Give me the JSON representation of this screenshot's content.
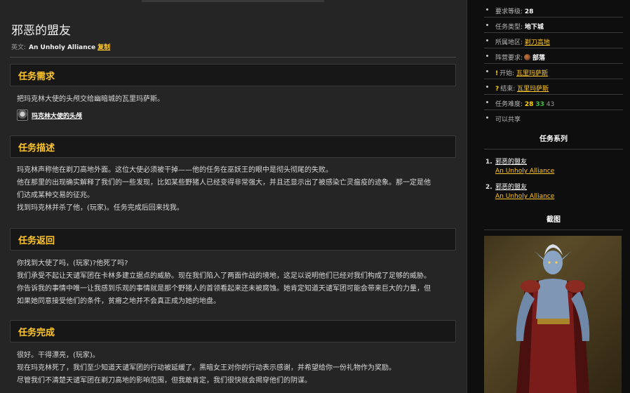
{
  "quest": {
    "title": "邪恶的盟友",
    "en_label": "英文:",
    "en_name": "An Unholy Alliance",
    "copy_label": "复制"
  },
  "sections": {
    "requirements": {
      "heading": "任务需求",
      "text": "把玛克林大使的头颅交给幽暗城的瓦里玛萨斯。",
      "item_name": "玛克林大使的头颅",
      "item_icon": "severed-head-icon"
    },
    "description": {
      "heading": "任务描述",
      "lines": [
        "玛克林声称他在剃刀高地外面。这位大使必须被干掉——他的任务在巫妖王的眼中是彻头彻尾的失败。",
        "他在那里的出现确实解释了我们的一些发现，比如某些野猪人已经变得非常强大，并且还显示出了被感染亡灵瘟疫的迹象。那一定是他",
        "们达成某种交易的征兆。",
        "找到玛克林并杀了他，(玩家)。任务完成后回来找我。"
      ]
    },
    "progress": {
      "heading": "任务返回",
      "lines": [
        "你找到大使了吗，(玩家)?他死了吗?",
        "我们承受不起让天谴军团在卡林多建立据点的威胁。现在我们陷入了两面作战的境地，这足以说明他们已经对我们构成了足够的威胁。",
        "你告诉我的事情中唯一让我感到乐观的事情就是那个野猪人的首领看起来还未被腐蚀。她肯定知道天谴军团可能会带来巨大的力量，但",
        "如果她同意接受他们的条件，贫瘠之地并不会真正成为她的地盘。"
      ]
    },
    "completion": {
      "heading": "任务完成",
      "lines": [
        "很好。干得漂亮，(玩家)。",
        "现在玛克林死了，我们至少知道天谴军团的行动被延缓了。黑暗女王对你的行动表示感谢，并希望给你一份礼物作为奖励。",
        "尽管我们不清楚天谴军团在剃刀高地的影响范围，但我敢肯定，我们很快就会揭穿他们的阴谋。"
      ]
    }
  },
  "sidebar": {
    "info": [
      {
        "label": "要求等级:",
        "value": "28"
      },
      {
        "label": "任务类型:",
        "value": "地下城"
      },
      {
        "label": "所属地区:",
        "value": "剃刀高地"
      },
      {
        "label": "阵营要求:",
        "value": "部落"
      },
      {
        "label": "开始:",
        "value": "瓦里玛萨斯"
      },
      {
        "label": "结束:",
        "value": "瓦里玛萨斯"
      },
      {
        "label": "任务难度:",
        "values": [
          "28",
          "33",
          "43"
        ]
      },
      {
        "label": "可以共享"
      }
    ],
    "series_heading": "任务系列",
    "series": [
      {
        "num": "1.",
        "zh": "邪恶的盟友",
        "en": "An Unholy Alliance"
      },
      {
        "num": "2.",
        "zh": "邪恶的盟友",
        "en": "An Unholy Alliance"
      }
    ],
    "screenshot_heading": "截图",
    "colors": {
      "accent": "#ffc52d",
      "link": "#ffc72c",
      "easy": "#3fbf3f"
    }
  }
}
